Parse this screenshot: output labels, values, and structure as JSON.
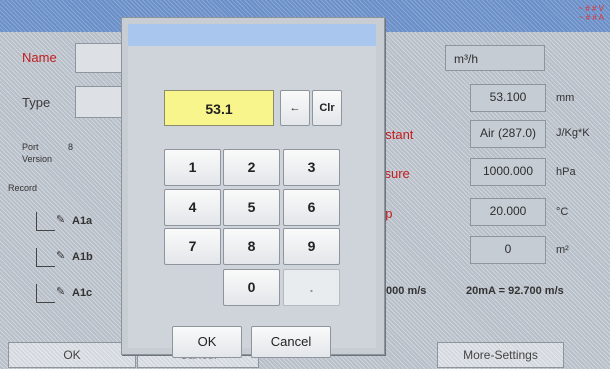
{
  "status": {
    "voltage": "~ # # V",
    "current": "~ # # A"
  },
  "form": {
    "name_label": "Name",
    "type_label": "Type",
    "port_label": "Port",
    "port_value": "8",
    "version_label": "Version",
    "record_label": "Record",
    "sensors": [
      "A1a",
      "A1b",
      "A1c"
    ]
  },
  "right": {
    "unit_button": "m³/h",
    "rows": [
      {
        "label": "r",
        "value": "53.100",
        "unit": "mm"
      },
      {
        "label": "nstant",
        "value": "Air (287.0)",
        "unit": "J/Kg*K"
      },
      {
        "label": "ssure",
        "value": "1000.000",
        "unit": "hPa"
      },
      {
        "label": "ap",
        "value": "20.000",
        "unit": "°C"
      },
      {
        "label": "",
        "value": "0",
        "unit": "m²"
      }
    ],
    "scale_low": ".000 m/s",
    "scale_high": "20mA = 92.700 m/s"
  },
  "bottom": {
    "ok": "OK",
    "cancel": "Cancel",
    "more_settings": "More-Settings"
  },
  "keypad": {
    "display_value": "53.1",
    "backspace": "←",
    "clear": "Clr",
    "keys": [
      "1",
      "2",
      "3",
      "4",
      "5",
      "6",
      "7",
      "8",
      "9"
    ],
    "zero": "0",
    "dot": ".",
    "ok": "OK",
    "cancel": "Cancel"
  },
  "colors": {
    "accent_red": "#c11d1d",
    "display_yellow": "#f8f58c",
    "title_blue": "#a9c6ee"
  }
}
